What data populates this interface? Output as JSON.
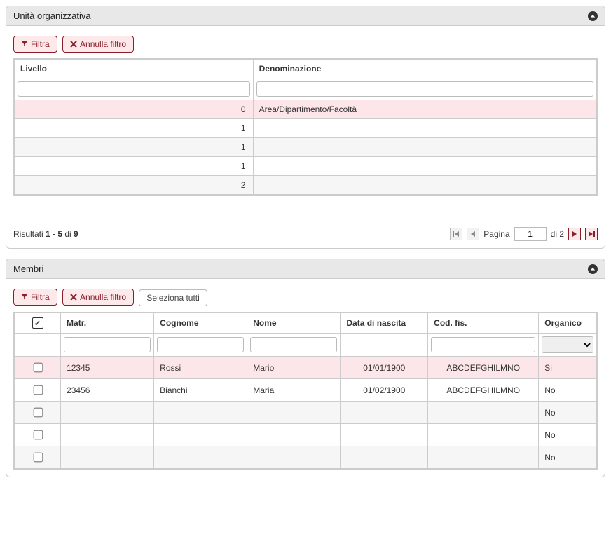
{
  "unit_panel": {
    "title": "Unità organizzativa",
    "filter_btn": "Filtra",
    "cancel_filter_btn": "Annulla filtro",
    "columns": {
      "level": "Livello",
      "name": "Denominazione"
    },
    "rows": [
      {
        "level": "0",
        "name": "Area/Dipartimento/Facoltà"
      },
      {
        "level": "1",
        "name": ""
      },
      {
        "level": "1",
        "name": ""
      },
      {
        "level": "1",
        "name": ""
      },
      {
        "level": "2",
        "name": ""
      }
    ],
    "results_prefix": "Risultati ",
    "results_range": "1 - 5",
    "results_mid": " di ",
    "results_total": "9",
    "page_label": "Pagina",
    "page_current": "1",
    "page_of": "di 2"
  },
  "members_panel": {
    "title": "Membri",
    "filter_btn": "Filtra",
    "cancel_filter_btn": "Annulla filtro",
    "select_all_btn": "Seleziona tutti",
    "columns": {
      "matr": "Matr.",
      "cognome": "Cognome",
      "nome": "Nome",
      "data": "Data di nascita",
      "cod": "Cod. fis.",
      "organico": "Organico"
    },
    "rows": [
      {
        "matr": "12345",
        "cognome": "Rossi",
        "nome": "Mario",
        "data": "01/01/1900",
        "cod": "ABCDEFGHILMNO",
        "organico": "Si"
      },
      {
        "matr": "23456",
        "cognome": "Bianchi",
        "nome": "Maria",
        "data": "01/02/1900",
        "cod": "ABCDEFGHILMNO",
        "organico": "No"
      },
      {
        "matr": "",
        "cognome": "",
        "nome": "",
        "data": "",
        "cod": "",
        "organico": "No"
      },
      {
        "matr": "",
        "cognome": "",
        "nome": "",
        "data": "",
        "cod": "",
        "organico": "No"
      },
      {
        "matr": "",
        "cognome": "",
        "nome": "",
        "data": "",
        "cod": "",
        "organico": "No"
      }
    ]
  }
}
